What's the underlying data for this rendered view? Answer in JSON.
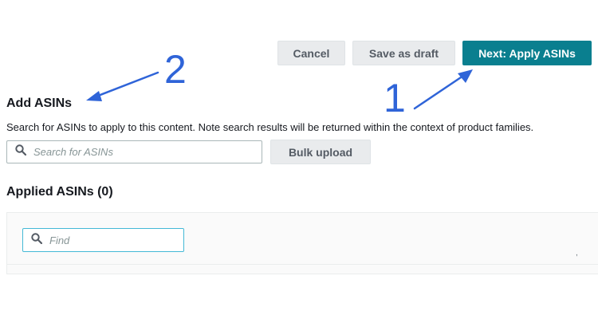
{
  "toolbar": {
    "cancel_label": "Cancel",
    "save_draft_label": "Save as draft",
    "next_label": "Next: Apply ASINs"
  },
  "add_asins": {
    "title": "Add ASINs",
    "description": "Search for ASINs to apply to this content. Note search results will be returned within the context of product families.",
    "search_placeholder": "Search for ASINs",
    "bulk_upload_label": "Bulk upload"
  },
  "applied_asins": {
    "title": "Applied ASINs (0)",
    "find_placeholder": "Find",
    "stray_mark": ","
  },
  "annotations": {
    "step_1": "1",
    "step_2": "2",
    "color": "#2f64d8"
  },
  "colors": {
    "primary_button": "#0a7f8f",
    "secondary_button": "#e9ebed",
    "focus_border": "#44b9d6"
  },
  "icons": [
    "search-icon",
    "search-icon"
  ]
}
